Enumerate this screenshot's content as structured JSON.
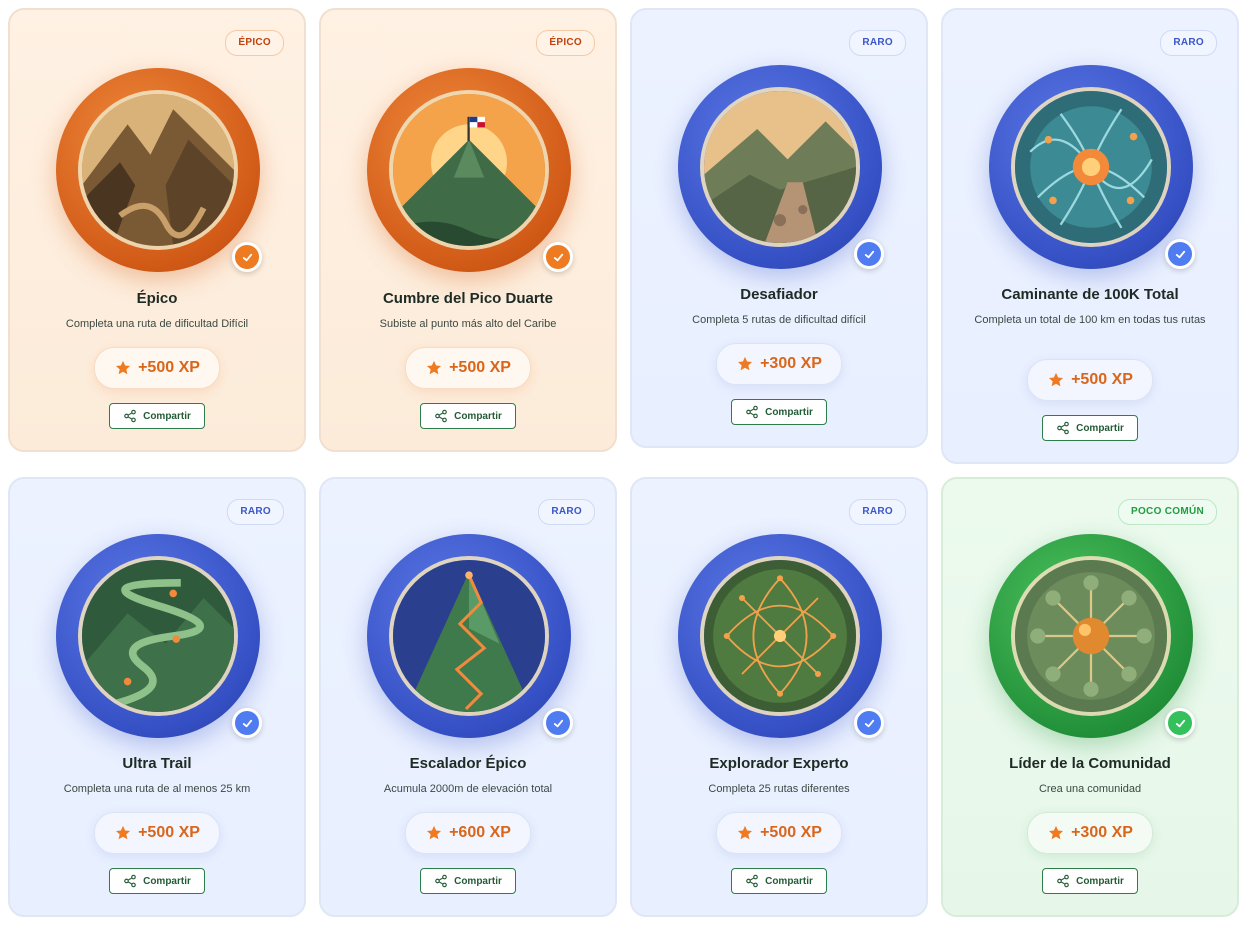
{
  "share_label": "Compartir",
  "achievements": [
    {
      "title": "Épico",
      "description": "Completa una ruta de dificultad Difícil",
      "xp": "+500 XP",
      "rarity": "ÉPICO",
      "tier": "epic",
      "art": "cliff-trail"
    },
    {
      "title": "Cumbre del Pico Duarte",
      "description": "Subiste al punto más alto del Caribe",
      "xp": "+500 XP",
      "rarity": "ÉPICO",
      "tier": "epic",
      "art": "summit-flag"
    },
    {
      "title": "Desafiador",
      "description": "Completa 5 rutas de dificultad difícil",
      "xp": "+300 XP",
      "rarity": "RARO",
      "tier": "rare",
      "art": "rocky-path"
    },
    {
      "title": "Caminante de 100K Total",
      "description": "Completa un total de 100 km en todas tus rutas",
      "xp": "+500 XP",
      "rarity": "RARO",
      "tier": "rare",
      "art": "network-sun"
    },
    {
      "title": "Ultra Trail",
      "description": "Completa una ruta de al menos 25 km",
      "xp": "+500 XP",
      "rarity": "RARO",
      "tier": "rare",
      "art": "winding-trail"
    },
    {
      "title": "Escalador Épico",
      "description": "Acumula 2000m de elevación total",
      "xp": "+600 XP",
      "rarity": "RARO",
      "tier": "rare",
      "art": "zigzag-peak"
    },
    {
      "title": "Explorador Experto",
      "description": "Completa 25 rutas diferentes",
      "xp": "+500 XP",
      "rarity": "RARO",
      "tier": "rare",
      "art": "route-map"
    },
    {
      "title": "Líder de la Comunidad",
      "description": "Crea una comunidad",
      "xp": "+300 XP",
      "rarity": "POCO COMÚN",
      "tier": "uncommon",
      "art": "community-nodes"
    }
  ],
  "colors": {
    "epic": "#ee7a21",
    "rare": "#3550c4",
    "uncommon": "#23913a",
    "xp_text": "#d9661b",
    "share_border": "#2f7d4a"
  },
  "icons": {
    "check": "check-icon",
    "star": "star-icon",
    "share": "share-icon"
  }
}
